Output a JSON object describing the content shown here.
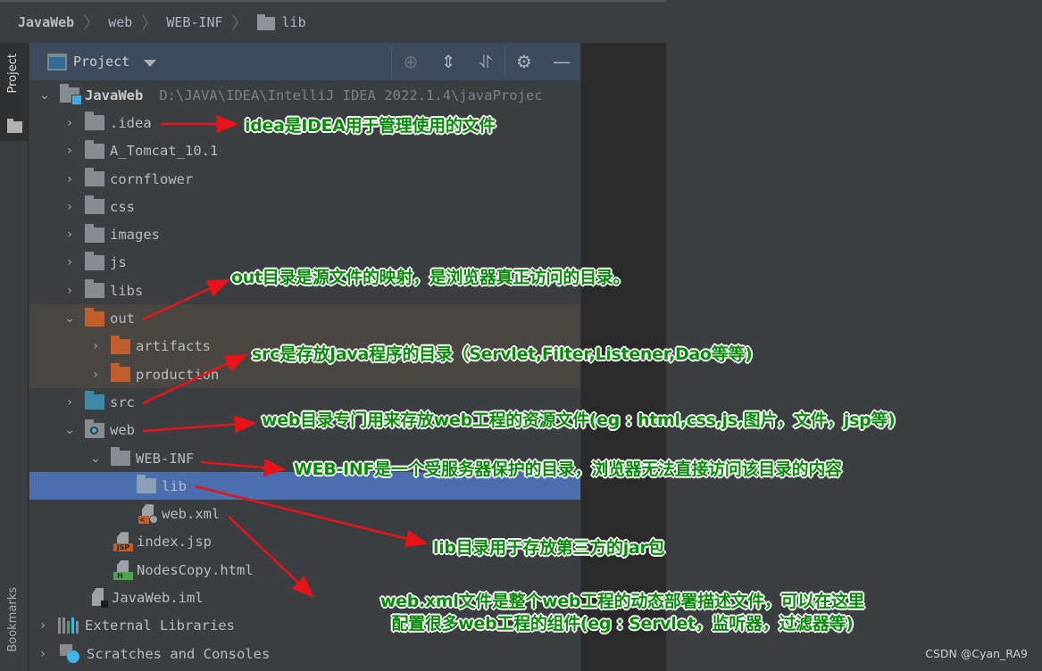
{
  "breadcrumb": [
    "JavaWeb",
    "web",
    "WEB-INF",
    "lib"
  ],
  "left_stripe": {
    "project_tab": "Project",
    "bookmarks_tab": "Bookmarks"
  },
  "panel": {
    "title": "Project",
    "tools": [
      "locate-icon",
      "expand-all-icon",
      "collapse-all-icon",
      "gear-icon",
      "hide-icon"
    ]
  },
  "tree": {
    "root": {
      "name": "JavaWeb",
      "path": "D:\\JAVA\\IDEA\\IntelliJ IDEA 2022.1.4\\javaProjec"
    },
    "items": [
      {
        "name": ".idea",
        "type": "folder",
        "expanded": false
      },
      {
        "name": "A_Tomcat_10.1",
        "type": "folder",
        "expanded": false
      },
      {
        "name": "cornflower",
        "type": "folder",
        "expanded": false
      },
      {
        "name": "css",
        "type": "folder",
        "expanded": false
      },
      {
        "name": "images",
        "type": "folder",
        "expanded": false
      },
      {
        "name": "js",
        "type": "folder",
        "expanded": false
      },
      {
        "name": "libs",
        "type": "folder",
        "expanded": false
      },
      {
        "name": "out",
        "type": "excluded-folder",
        "expanded": true
      },
      {
        "name": "artifacts",
        "type": "excluded-folder",
        "expanded": false
      },
      {
        "name": "production",
        "type": "excluded-folder",
        "expanded": false
      },
      {
        "name": "src",
        "type": "source-folder",
        "expanded": false
      },
      {
        "name": "web",
        "type": "web-folder",
        "expanded": true
      },
      {
        "name": "WEB-INF",
        "type": "folder",
        "expanded": true
      },
      {
        "name": "lib",
        "type": "folder",
        "selected": true
      },
      {
        "name": "web.xml",
        "type": "xml-file"
      },
      {
        "name": "index.jsp",
        "type": "jsp-file"
      },
      {
        "name": "NodesCopy.html",
        "type": "html-file"
      },
      {
        "name": "JavaWeb.iml",
        "type": "iml-file"
      },
      {
        "name": "External Libraries",
        "type": "libraries",
        "expanded": false
      },
      {
        "name": "Scratches and Consoles",
        "type": "scratches",
        "expanded": false
      }
    ]
  },
  "annotations": {
    "idea": "idea是IDEA用于管理使用的文件",
    "out": "out目录是源文件的映射，是浏览器真正访问的目录。",
    "src": "src是存放Java程序的目录（Servlet,Filter,Listener,Dao等等)",
    "web": "web目录专门用来存放web工程的资源文件(eg : html,css,js,图片，文件，jsp等)",
    "webinf": "WEB-INF是一个受服务器保护的目录，浏览器无法直接访问该目录的内容",
    "lib": "lib目录用于存放第三方的jar包",
    "webxml_line1": "web.xml文件是整个web工程的动态部署描述文件，可以在这里",
    "webxml_line2": "配置很多web工程的组件(eg : Servlet，监听器，过滤器等)"
  },
  "colors": {
    "annotation_text": "#0a8a0a",
    "arrow": "#e8141a",
    "selection": "#4b6eaf",
    "excluded_bg": "#4a4641"
  },
  "watermark": "CSDN @Cyan_RA9"
}
